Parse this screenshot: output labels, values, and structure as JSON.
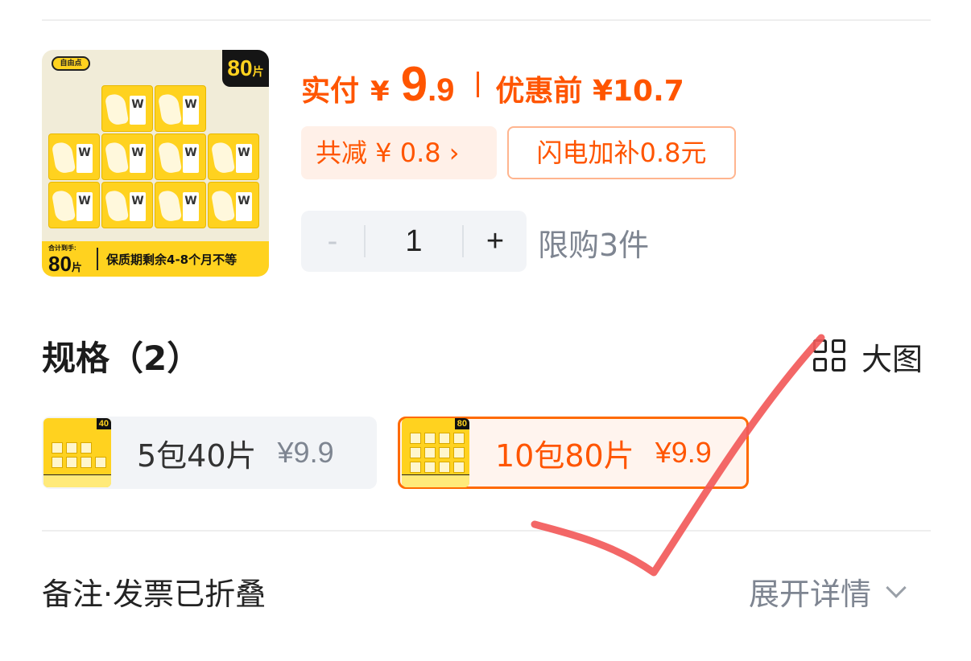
{
  "product": {
    "brand": "自由点",
    "count_badge": "80",
    "count_unit": "片",
    "total_label": "合计到手:",
    "total_value": "80",
    "total_unit": "片",
    "shelf_life": "保质期剩余4-8个月不等"
  },
  "price": {
    "paid_label": "实付",
    "yen": "¥",
    "int": "9",
    "dec": ".9",
    "original": "优惠前 ¥10.7"
  },
  "discount": {
    "reduce_label": "共减 ¥ 0.8 ›",
    "subsidy_label": "闪电加补0.8元"
  },
  "quantity": {
    "minus": "-",
    "value": "1",
    "plus": "+",
    "limit": "限购3件"
  },
  "spec": {
    "title": "规格（2）",
    "big_image_label": "大图",
    "options": [
      {
        "name": "5包40片",
        "price": "¥9.9",
        "badge": "40",
        "selected": false
      },
      {
        "name": "10包80片",
        "price": "¥9.9",
        "badge": "80",
        "selected": true
      }
    ]
  },
  "footer": {
    "notes_label": "备注·发票已折叠",
    "expand_label": "展开详情"
  },
  "colors": {
    "accent": "#ff5500",
    "annotation": "#f25a5a"
  },
  "icons": [
    "grid-icon",
    "chevron-down-icon"
  ]
}
